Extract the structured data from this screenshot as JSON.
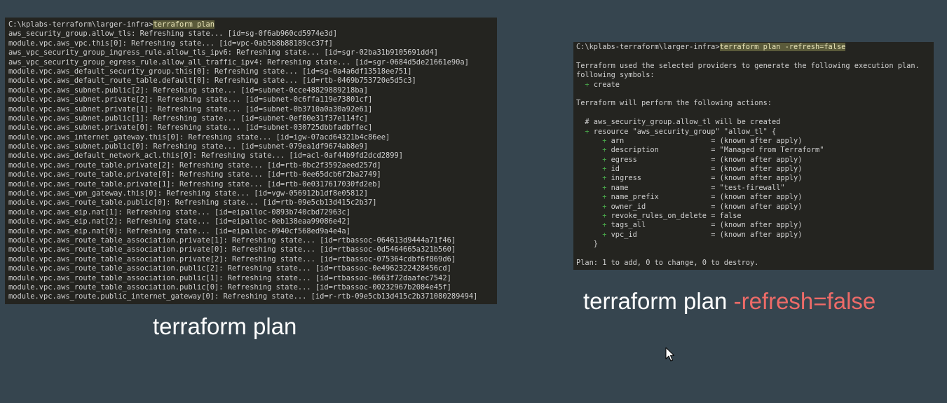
{
  "left_terminal": {
    "prompt": "C:\\kplabs-terraform\\larger-infra>",
    "command": "terraform plan",
    "lines": [
      "aws_security_group.allow_tls: Refreshing state... [id=sg-0f6ab960cd5974e3d]",
      "module.vpc.aws_vpc.this[0]: Refreshing state... [id=vpc-0ab5b8b88189cc37f]",
      "aws_vpc_security_group_ingress_rule.allow_tls_ipv6: Refreshing state... [id=sgr-02ba31b9105691dd4]",
      "aws_vpc_security_group_egress_rule.allow_all_traffic_ipv4: Refreshing state... [id=sgr-0684d5de21661e90a]",
      "module.vpc.aws_default_security_group.this[0]: Refreshing state... [id=sg-0a4a6df13518ee751]",
      "module.vpc.aws_default_route_table.default[0]: Refreshing state... [id=rtb-0469b753720e5d5c3]",
      "module.vpc.aws_subnet.public[2]: Refreshing state... [id=subnet-0cce48829889218ba]",
      "module.vpc.aws_subnet.private[2]: Refreshing state... [id=subnet-0c6ffa119e73801cf]",
      "module.vpc.aws_subnet.private[1]: Refreshing state... [id=subnet-0b3710a0a30a92e61]",
      "module.vpc.aws_subnet.public[1]: Refreshing state... [id=subnet-0ef80e31f37e114fc]",
      "module.vpc.aws_subnet.private[0]: Refreshing state... [id=subnet-030725dbbfadbffec]",
      "module.vpc.aws_internet_gateway.this[0]: Refreshing state... [id=igw-07acd64321b4c86ee]",
      "module.vpc.aws_subnet.public[0]: Refreshing state... [id=subnet-079ea1df9674ab8e9]",
      "module.vpc.aws_default_network_acl.this[0]: Refreshing state... [id=acl-0af44b9fd2dcd2899]",
      "module.vpc.aws_route_table.private[2]: Refreshing state... [id=rtb-0bc2f3592aeed257d]",
      "module.vpc.aws_route_table.private[0]: Refreshing state... [id=rtb-0ee65dcb6f2ba2749]",
      "module.vpc.aws_route_table.private[1]: Refreshing state... [id=rtb-0e0317617030fd2eb]",
      "module.vpc.aws_vpn_gateway.this[0]: Refreshing state... [id=vgw-056912b1df8e05812]",
      "module.vpc.aws_route_table.public[0]: Refreshing state... [id=rtb-09e5cb13d415c2b37]",
      "module.vpc.aws_eip.nat[1]: Refreshing state... [id=eipalloc-0893b740cbd72963c]",
      "module.vpc.aws_eip.nat[2]: Refreshing state... [id=eipalloc-0eb138eaa99086e42]",
      "module.vpc.aws_eip.nat[0]: Refreshing state... [id=eipalloc-0940cf568ed9a4e4a]",
      "module.vpc.aws_route_table_association.private[1]: Refreshing state... [id=rtbassoc-064613d9444a71f46]",
      "module.vpc.aws_route_table_association.private[0]: Refreshing state... [id=rtbassoc-0d5464665a321b560]",
      "module.vpc.aws_route_table_association.private[2]: Refreshing state... [id=rtbassoc-075364cdbf6f869d6]",
      "module.vpc.aws_route_table_association.public[2]: Refreshing state... [id=rtbassoc-0e4962322428456cd]",
      "module.vpc.aws_route_table_association.public[1]: Refreshing state... [id=rtbassoc-0663f72daafec7542]",
      "module.vpc.aws_route_table_association.public[0]: Refreshing state... [id=rtbassoc-00232967b2084e45f]",
      "module.vpc.aws_route.public_internet_gateway[0]: Refreshing state... [id=r-rtb-09e5cb13d415c2b371080289494]"
    ]
  },
  "right_terminal": {
    "prompt": "C:\\kplabs-terraform\\larger-infra>",
    "command": "terraform plan -refresh=false",
    "intro_1": "Terraform used the selected providers to generate the following execution plan.",
    "intro_2": "following symbols:",
    "symbol_plus": "+",
    "symbol_label": "create",
    "actions_header": "Terraform will perform the following actions:",
    "resource_comment": "  # aws_security_group.allow_tl will be created",
    "resource_decl": " resource \"aws_security_group\" \"allow_tl\" {",
    "attributes": [
      {
        "name": "arn",
        "value": "(known after apply)"
      },
      {
        "name": "description",
        "value": "\"Managed from Terraform\""
      },
      {
        "name": "egress",
        "value": "(known after apply)"
      },
      {
        "name": "id",
        "value": "(known after apply)"
      },
      {
        "name": "ingress",
        "value": "(known after apply)"
      },
      {
        "name": "name",
        "value": "\"test-firewall\""
      },
      {
        "name": "name_prefix",
        "value": "(known after apply)"
      },
      {
        "name": "owner_id",
        "value": "(known after apply)"
      },
      {
        "name": "revoke_rules_on_delete",
        "value": "false"
      },
      {
        "name": "tags_all",
        "value": "(known after apply)"
      },
      {
        "name": "vpc_id",
        "value": "(known after apply)"
      }
    ],
    "closing_brace": "    }",
    "summary": "Plan: 1 to add, 0 to change, 0 to destroy."
  },
  "captions": {
    "left": "terraform plan",
    "right_main": "terraform plan ",
    "right_flag": "-refresh=false"
  },
  "colors": {
    "background": "#36454f",
    "terminal_bg": "#242420",
    "terminal_text": "#cfcfcf",
    "plus_green": "#49a84a",
    "flag_red": "#ee6b68",
    "command_highlight": "#5a5a3a"
  }
}
